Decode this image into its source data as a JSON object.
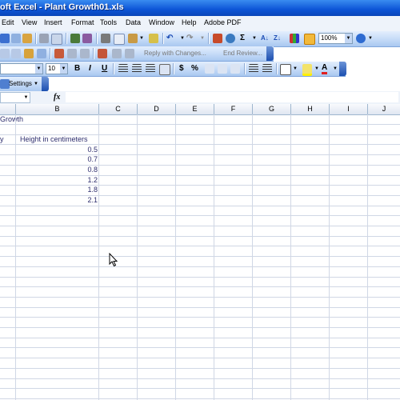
{
  "window": {
    "title": "oft Excel - Plant Growth01.xls"
  },
  "menu": [
    "Edit",
    "View",
    "Insert",
    "Format",
    "Tools",
    "Data",
    "Window",
    "Help",
    "Adobe PDF"
  ],
  "toolbar": {
    "zoom": "100%",
    "sigma": "Σ",
    "reply_with_changes": "Reply with Changes...",
    "end_review": "End Review...",
    "font_size": "10",
    "bold": "B",
    "italic": "I",
    "underline": "U",
    "currency": "$",
    "percent": "%",
    "font_color_letter": "A",
    "settings": "Settings"
  },
  "formula_bar": {
    "fx": "fx",
    "name_box": "",
    "content": ""
  },
  "columns": [
    "B",
    "C",
    "D",
    "E",
    "F",
    "G",
    "H",
    "I",
    "J"
  ],
  "cells": {
    "a1": "Growth",
    "a3": "y",
    "b3": "Height in centimeters",
    "values": [
      "0.5",
      "0.7",
      "0.8",
      "1.2",
      "1.8",
      "2.1"
    ]
  },
  "colors": {
    "titlebar": "#0c54d6",
    "accent": "#2e2e6e"
  }
}
